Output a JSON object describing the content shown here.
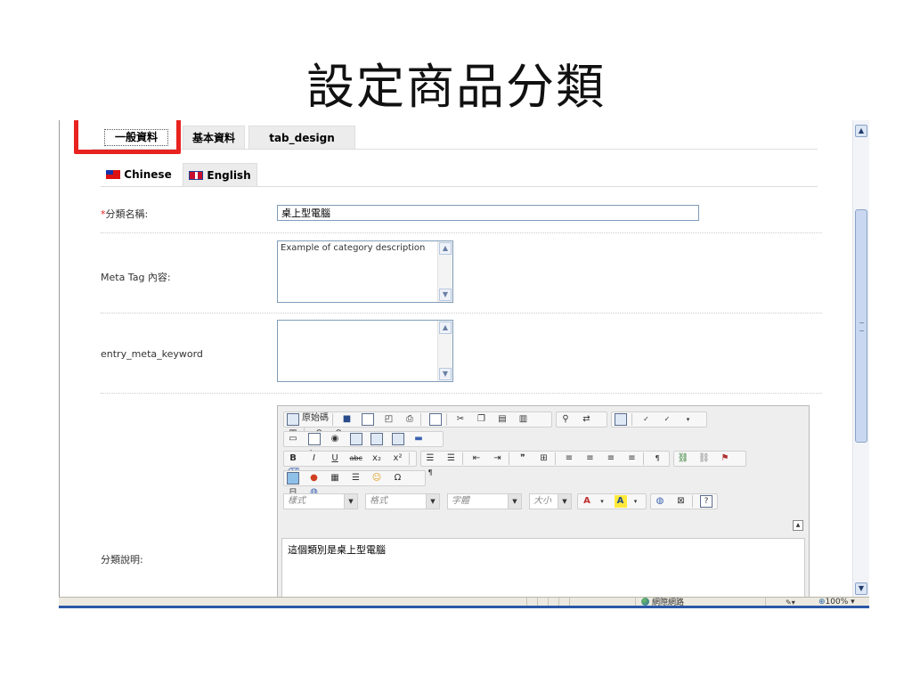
{
  "slide": {
    "title": "設定商品分類"
  },
  "tabs": [
    {
      "label": "一般資料",
      "active": true
    },
    {
      "label": "基本資料",
      "active": false
    },
    {
      "label": "tab_design",
      "active": false
    }
  ],
  "language_tabs": [
    {
      "label": "Chinese",
      "active": true
    },
    {
      "label": "English",
      "active": false
    }
  ],
  "form": {
    "name": {
      "required_mark": "*",
      "label": "分類名稱:",
      "value": "桌上型電腦"
    },
    "meta_description": {
      "label": "Meta Tag 內容:",
      "value": "Example of category description"
    },
    "meta_keyword": {
      "label": "entry_meta_keyword",
      "value": ""
    },
    "description": {
      "label": "分類說明:",
      "value": "這個類別是桌上型電腦"
    }
  },
  "editor": {
    "source_label": "原始碼",
    "style_combo": "樣式",
    "format_combo": "格式",
    "font_combo": "字體",
    "size_combo": "大小"
  },
  "statusbar": {
    "zone": "網際網路",
    "zoom": "100%"
  },
  "colors": {
    "highlight": "#e8231f",
    "input_border": "#7f9db9",
    "status_line": "#2b58a8"
  }
}
